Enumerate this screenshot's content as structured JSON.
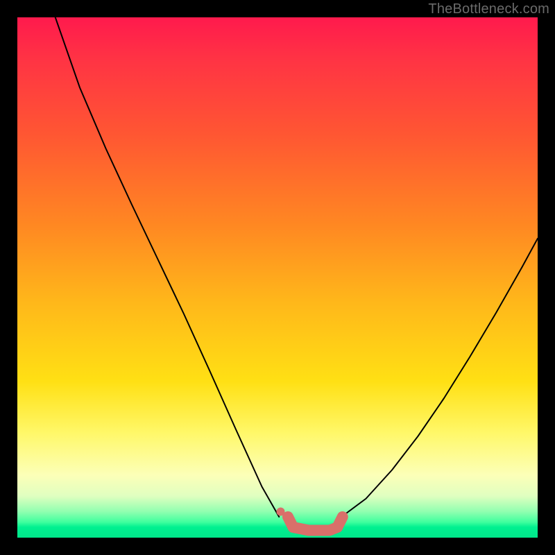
{
  "watermark": "TheBottleneck.com",
  "chart_data": {
    "type": "line",
    "title": "",
    "xlabel": "",
    "ylabel": "",
    "xlim": [
      0,
      1
    ],
    "ylim": [
      0,
      1
    ],
    "note": "Axes are unlabeled in the source image; x/y are normalized 0–1. Two line series form a V shape meeting near a flat bottom segment. A marker and a thick colored stroke highlight the bottom region.",
    "series": [
      {
        "name": "left-curve",
        "color": "#000000",
        "stroke_width": 2,
        "x": [
          0.073,
          0.12,
          0.17,
          0.22,
          0.27,
          0.32,
          0.37,
          0.42,
          0.47,
          0.503
        ],
        "y": [
          1.0,
          0.865,
          0.748,
          0.64,
          0.535,
          0.43,
          0.32,
          0.208,
          0.098,
          0.04
        ]
      },
      {
        "name": "right-curve",
        "color": "#000000",
        "stroke_width": 2,
        "x": [
          0.623,
          0.67,
          0.72,
          0.77,
          0.82,
          0.87,
          0.92,
          0.97,
          1.0
        ],
        "y": [
          0.04,
          0.075,
          0.13,
          0.195,
          0.268,
          0.348,
          0.432,
          0.52,
          0.575
        ]
      },
      {
        "name": "bottom-highlight",
        "color": "#d9706a",
        "stroke_width": 16,
        "x": [
          0.52,
          0.53,
          0.56,
          0.6,
          0.615,
          0.625
        ],
        "y": [
          0.04,
          0.02,
          0.014,
          0.014,
          0.02,
          0.04
        ]
      }
    ],
    "markers": [
      {
        "name": "left-dot",
        "x": 0.506,
        "y": 0.05,
        "r": 6,
        "color": "#d9706a"
      }
    ]
  },
  "colors": {
    "background": "#000000",
    "curve": "#000000",
    "highlight": "#d9706a",
    "watermark": "#6b6b6b"
  }
}
